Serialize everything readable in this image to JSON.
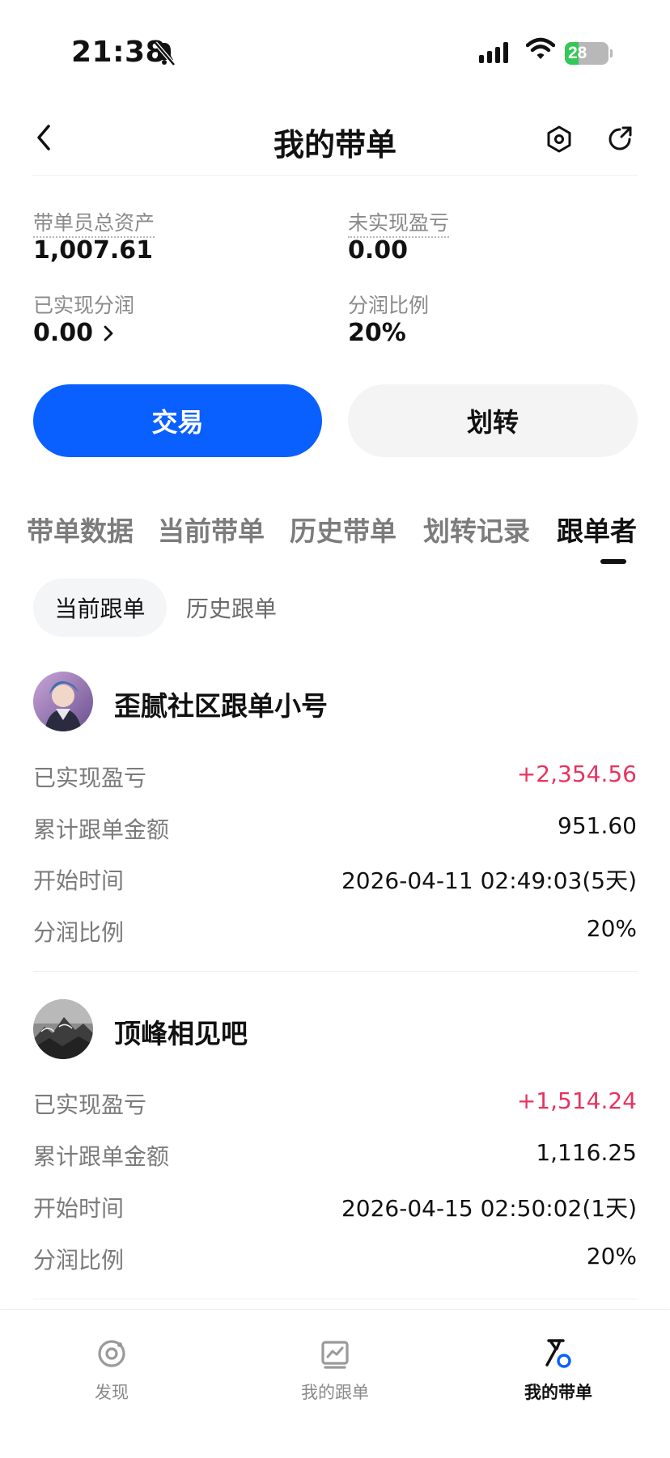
{
  "status_bar": {
    "time": "21:38",
    "battery": "28"
  },
  "header": {
    "title": "我的带单"
  },
  "stats": {
    "total_assets_label": "带单员总资产",
    "total_assets_value": "1,007.61",
    "unrealized_pnl_label": "未实现盈亏",
    "unrealized_pnl_value": "0.00",
    "realized_share_label": "已实现分润",
    "realized_share_value": "0.00",
    "share_ratio_label": "分润比例",
    "share_ratio_value": "20%"
  },
  "actions": {
    "trade_label": "交易",
    "transfer_label": "划转"
  },
  "tabs": [
    "带单数据",
    "当前带单",
    "历史带单",
    "划转记录",
    "跟单者"
  ],
  "subtabs": [
    "当前跟单",
    "历史跟单"
  ],
  "row_labels": {
    "realized_pnl": "已实现盈亏",
    "total_amount": "累计跟单金额",
    "start_time": "开始时间",
    "share_ratio": "分润比例"
  },
  "followers": [
    {
      "name": "歪腻社区跟单小号",
      "realized_pnl": "+2,354.56",
      "total_amount": "951.60",
      "start_time": "2026-04-11 02:49:03(5天)",
      "share_ratio": "20%"
    },
    {
      "name": "顶峰相见吧",
      "realized_pnl": "+1,514.24",
      "total_amount": "1,116.25",
      "start_time": "2026-04-15 02:50:02(1天)",
      "share_ratio": "20%"
    }
  ],
  "bottom_nav": [
    {
      "label": "发现",
      "icon": "discover-icon"
    },
    {
      "label": "我的跟单",
      "icon": "chart-icon"
    },
    {
      "label": "我的带单",
      "icon": "lead-trade-icon"
    }
  ],
  "colors": {
    "accent": "#0a5fff",
    "profit": "#e8335f"
  }
}
